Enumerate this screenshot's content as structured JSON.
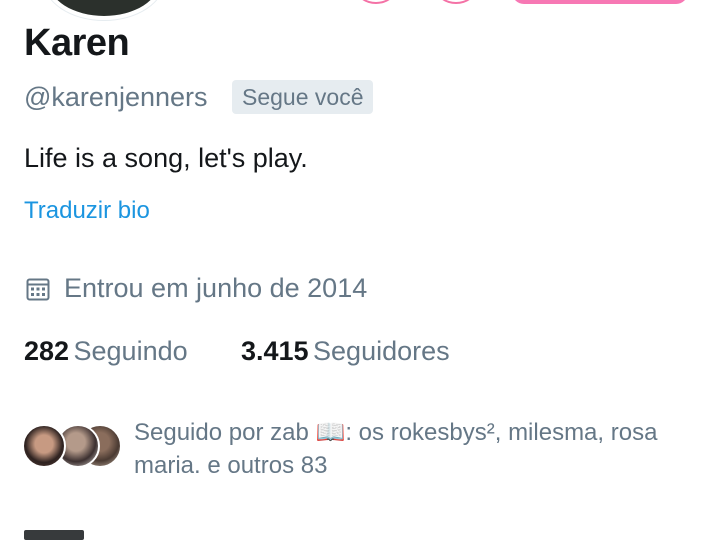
{
  "profile": {
    "name": "Karen",
    "handle": "@karenjenners",
    "follows_you_badge": "Segue você",
    "bio": "Life is a song, let's play.",
    "translate_bio": "Traduzir bio",
    "joined": "Entrou em junho de 2014"
  },
  "stats": {
    "following_count": "282",
    "following_label": "Seguindo",
    "followers_count": "3.415",
    "followers_label": "Seguidores"
  },
  "followed_by": {
    "text": "Seguido por zab 📖: os rokesbys², milesma, rosa maria. e outros 83"
  },
  "icons": {
    "calendar": "calendar-icon"
  },
  "colors": {
    "accent_pink": "#f472a6",
    "link_blue": "#1b95e0",
    "secondary_text": "#657786"
  }
}
